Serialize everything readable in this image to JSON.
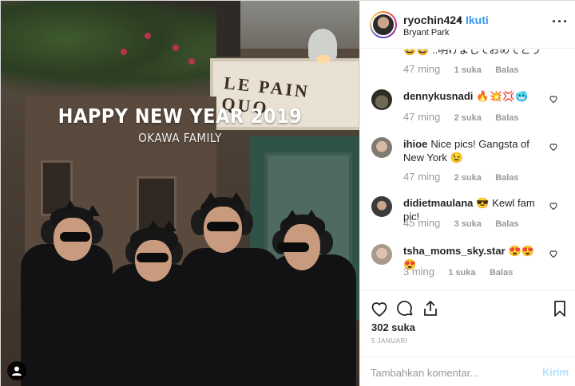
{
  "photo": {
    "overlay_title": "HAPPY NEW YEAR 2019",
    "overlay_subtitle": "OKAWA FAMILY",
    "storefront_sign": "LE PAIN QUO"
  },
  "header": {
    "username": "ryochin424",
    "separator": "•",
    "follow_label": "Ikuti",
    "location": "Bryant Park",
    "more_label": "···"
  },
  "comments": [
    {
      "username": "",
      "text": "😆😆 ..明けましておめでとう",
      "time": "47 ming",
      "likes": "1 suka",
      "reply": "Balas"
    },
    {
      "username": "dennykusnadi",
      "text": "🔥💥💢🥶",
      "time": "47 ming",
      "likes": "2 suka",
      "reply": "Balas"
    },
    {
      "username": "ihioe",
      "text": "Nice pics! Gangsta of New York 😉",
      "time": "47 ming",
      "likes": "2 suka",
      "reply": "Balas"
    },
    {
      "username": "didietmaulana",
      "text": "😎 Kewl fam pic!",
      "time": "45 ming",
      "likes": "3 suka",
      "reply": "Balas"
    },
    {
      "username": "tsha_moms_sky.star",
      "text": "😍😍😍",
      "time": "3 ming",
      "likes": "1 suka",
      "reply": "Balas"
    }
  ],
  "actions": {
    "likes_count": "302 suka",
    "date": "5 JANUARI"
  },
  "add_comment": {
    "placeholder": "Tambahkan komentar...",
    "post_label": "Kirim"
  },
  "colors": {
    "accent_blue": "#3897f0",
    "post_button_disabled": "#b2dffc",
    "meta_gray": "#999999",
    "text": "#262626"
  },
  "icons": [
    "user-tag-icon",
    "heart-icon",
    "comment-icon",
    "share-icon",
    "bookmark-icon",
    "more-options-icon"
  ]
}
